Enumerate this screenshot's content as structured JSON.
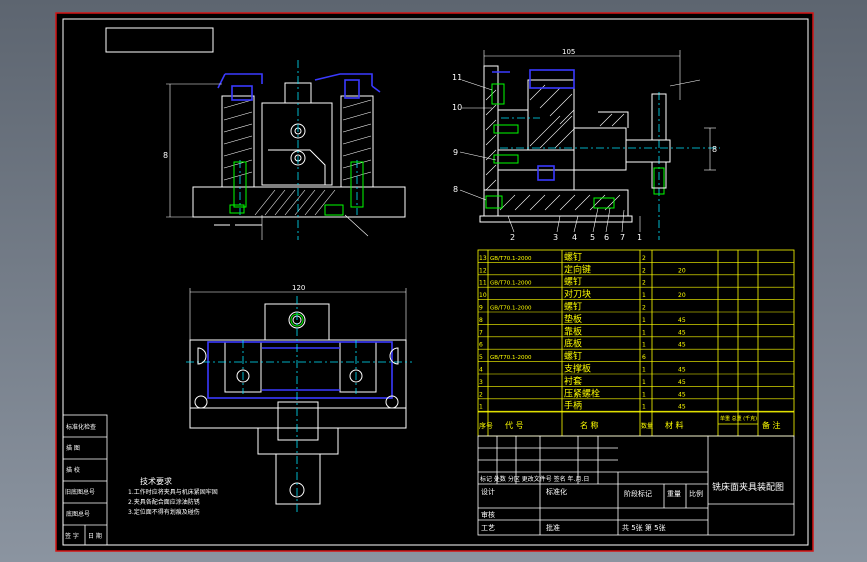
{
  "sheet": {
    "colors": {
      "background": "#000000",
      "border_outer": "#d41414",
      "border_inner": "#ffffff",
      "table": "#ffff00",
      "part": "#ffffff",
      "hatch": "#ffffff",
      "centerline": "#00e5ff",
      "hidden": "#3a3aff",
      "screw": "#00ff00"
    }
  },
  "views": {
    "front": {
      "dim_height": "8"
    },
    "side": {
      "dim_top": "105",
      "dim_right": "8",
      "callouts": [
        "11",
        "10",
        "9",
        "8",
        "2",
        "3",
        "4",
        "5",
        "6",
        "7",
        "1"
      ]
    },
    "top": {
      "dim_width": "120"
    }
  },
  "notes": {
    "title": "技术要求",
    "lines": [
      "1.工作时应将夹具与机床紧固牢固",
      "2.夹具各配合面应涂油防锈",
      "3.定位面不得有划痕及碰伤"
    ]
  },
  "side_table": [
    [
      "标准化检查"
    ],
    [
      "描 图"
    ],
    [
      "描 校"
    ],
    [
      "旧底图总号"
    ],
    [
      "底图总号"
    ],
    [
      "签 字",
      "日 期"
    ]
  ],
  "parts": [
    {
      "no": "13",
      "code": "GB/T70.1-2000",
      "name": "螺钉",
      "qty": "2",
      "material": "",
      "note": ""
    },
    {
      "no": "12",
      "code": "",
      "name": "定向键",
      "qty": "2",
      "material": "20",
      "note": ""
    },
    {
      "no": "11",
      "code": "GB/T70.1-2000",
      "name": "螺钉",
      "qty": "2",
      "material": "",
      "note": ""
    },
    {
      "no": "10",
      "code": "",
      "name": "对刀块",
      "qty": "1",
      "material": "20",
      "note": ""
    },
    {
      "no": "9",
      "code": "GB/T70.1-2000",
      "name": "螺钉",
      "qty": "2",
      "material": "",
      "note": ""
    },
    {
      "no": "8",
      "code": "",
      "name": "垫板",
      "qty": "1",
      "material": "45",
      "note": ""
    },
    {
      "no": "7",
      "code": "",
      "name": "靠板",
      "qty": "1",
      "material": "45",
      "note": ""
    },
    {
      "no": "6",
      "code": "",
      "name": "底板",
      "qty": "1",
      "material": "45",
      "note": ""
    },
    {
      "no": "5",
      "code": "GB/T70.1-2000",
      "name": "螺钉",
      "qty": "6",
      "material": "",
      "note": ""
    },
    {
      "no": "4",
      "code": "",
      "name": "支撑板",
      "qty": "1",
      "material": "45",
      "note": ""
    },
    {
      "no": "3",
      "code": "",
      "name": "衬套",
      "qty": "1",
      "material": "45",
      "note": ""
    },
    {
      "no": "2",
      "code": "",
      "name": "压紧螺栓",
      "qty": "1",
      "material": "45",
      "note": ""
    },
    {
      "no": "1",
      "code": "",
      "name": "手柄",
      "qty": "1",
      "material": "45",
      "note": ""
    }
  ],
  "parts_header": [
    "序号",
    "代 号",
    "名 称",
    "数量",
    "材 料",
    "单重 总重 (千克)",
    "备 注"
  ],
  "title_block": {
    "title": "铣床面夹具装配图",
    "r1": "标记 处数 分区 更改文件号 签名 年.月.日",
    "labels": [
      "设计",
      "标准化",
      "阶段标记",
      "重量",
      "比例",
      "审核",
      "工艺",
      "批准"
    ],
    "sheets": "共  5张 第  5张"
  }
}
